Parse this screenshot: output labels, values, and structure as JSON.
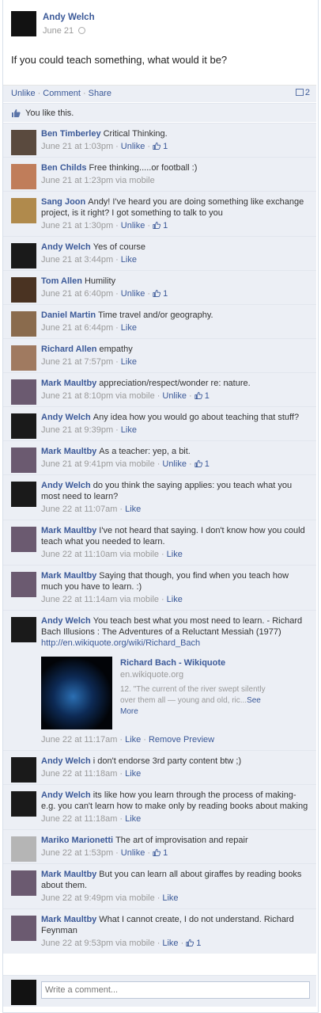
{
  "post": {
    "author": "Andy Welch",
    "date": "June 21",
    "status": "If you could teach something, what would it be?"
  },
  "actions": {
    "unlike": "Unlike",
    "comment": "Comment",
    "share": "Share",
    "comment_count": "2"
  },
  "likes": {
    "text": "You like this."
  },
  "comments": [
    {
      "name": "Ben Timberley",
      "text": "Critical Thinking.",
      "time": "June 21 at 1:03pm",
      "action": "Unlike",
      "likes": "1",
      "avatar_color": "#5a4a3e"
    },
    {
      "name": "Ben Childs",
      "text": "Free thinking.....or football :)",
      "time": "June 21 at 1:23pm via mobile",
      "action": "",
      "likes": "",
      "avatar_color": "#c07d5a"
    },
    {
      "name": "Sang Joon",
      "text": "Andy! I've heard you are doing something like exchange project, is it right? I got something to talk to you",
      "time": "June 21 at 1:30pm",
      "action": "Unlike",
      "likes": "1",
      "avatar_color": "#b08a4c"
    },
    {
      "name": "Andy Welch",
      "text": "Yes of course",
      "time": "June 21 at 3:44pm",
      "action": "Like",
      "likes": "",
      "avatar_color": "#1a1a1a"
    },
    {
      "name": "Tom Allen",
      "text": "Humility",
      "time": "June 21 at 6:40pm",
      "action": "Unlike",
      "likes": "1",
      "avatar_color": "#4a3322"
    },
    {
      "name": "Daniel Martin",
      "text": "Time travel and/or geography.",
      "time": "June 21 at 6:44pm",
      "action": "Like",
      "likes": "",
      "avatar_color": "#8a6b4d"
    },
    {
      "name": "Richard Allen",
      "text": "empathy",
      "time": "June 21 at 7:57pm",
      "action": "Like",
      "likes": "",
      "avatar_color": "#a07a60"
    },
    {
      "name": "Mark Maultby",
      "text": "appreciation/respect/wonder re: nature.",
      "time": "June 21 at 8:10pm via mobile",
      "action": "Unlike",
      "likes": "1",
      "avatar_color": "#6b5a70"
    },
    {
      "name": "Andy Welch",
      "text": "Any idea how you would go about teaching that stuff?",
      "time": "June 21 at 9:39pm",
      "action": "Like",
      "likes": "",
      "avatar_color": "#1a1a1a"
    },
    {
      "name": "Mark Maultby",
      "text": "As a teacher: yep, a bit.",
      "time": "June 21 at 9:41pm via mobile",
      "action": "Unlike",
      "likes": "1",
      "avatar_color": "#6b5a70"
    },
    {
      "name": "Andy Welch",
      "text": "do you think the saying applies: you teach what you most need to learn?",
      "time": "June 22 at 11:07am",
      "action": "Like",
      "likes": "",
      "avatar_color": "#1a1a1a"
    },
    {
      "name": "Mark Maultby",
      "text": "I've not heard that saying. I don't know how you could teach what you needed to learn.",
      "time": "June 22 at 11:10am via mobile",
      "action": "Like",
      "likes": "",
      "avatar_color": "#6b5a70"
    },
    {
      "name": "Mark Maultby",
      "text": "Saying that though, you find when you teach how much you have to learn. :)",
      "time": "June 22 at 11:14am via mobile",
      "action": "Like",
      "likes": "",
      "avatar_color": "#6b5a70"
    },
    {
      "name": "Andy Welch",
      "text": "You teach best what you most need to learn. - Richard Bach Illusions : The Adventures of a Reluctant Messiah (1977)",
      "link": "http://en.wikiquote.org/wiki/Richard_Bach",
      "time": "June 22 at 11:17am",
      "action": "Like",
      "extra": "Remove Preview",
      "likes": "",
      "avatar_color": "#1a1a1a",
      "preview": {
        "title": "Richard Bach - Wikiquote",
        "domain": "en.wikiquote.org",
        "desc": "12. \"The current of the river swept silently over them all — young and old, ric...",
        "more": "See More"
      }
    },
    {
      "name": "Andy Welch",
      "text": "i don't endorse 3rd party content btw ;)",
      "time": "June 22 at 11:18am",
      "action": "Like",
      "likes": "",
      "avatar_color": "#1a1a1a"
    },
    {
      "name": "Andy Welch",
      "text": "its like how you learn through the process of making- e.g. you can't learn how to make only by reading books about making",
      "time": "June 22 at 11:18am",
      "action": "Like",
      "likes": "",
      "avatar_color": "#1a1a1a"
    },
    {
      "name": "Mariko Marionetti",
      "text": "The art of improvisation and repair",
      "time": "June 22 at 1:53pm",
      "action": "Unlike",
      "likes": "1",
      "avatar_color": "#b5b5b5"
    },
    {
      "name": "Mark Maultby",
      "text": "But you can learn all about giraffes by reading books about them.",
      "time": "June 22 at 9:49pm via mobile",
      "action": "Like",
      "likes": "",
      "avatar_color": "#6b5a70"
    },
    {
      "name": "Mark Maultby",
      "text": "What I cannot create, I do not understand. Richard Feynman",
      "time": "June 22 at 9:53pm via mobile",
      "action": "Like",
      "likes": "1",
      "avatar_color": "#6b5a70"
    }
  ],
  "write": {
    "placeholder": "Write a comment..."
  },
  "colors": {
    "link": "#3b5998",
    "panel": "#eceff5",
    "meta": "#999999"
  }
}
